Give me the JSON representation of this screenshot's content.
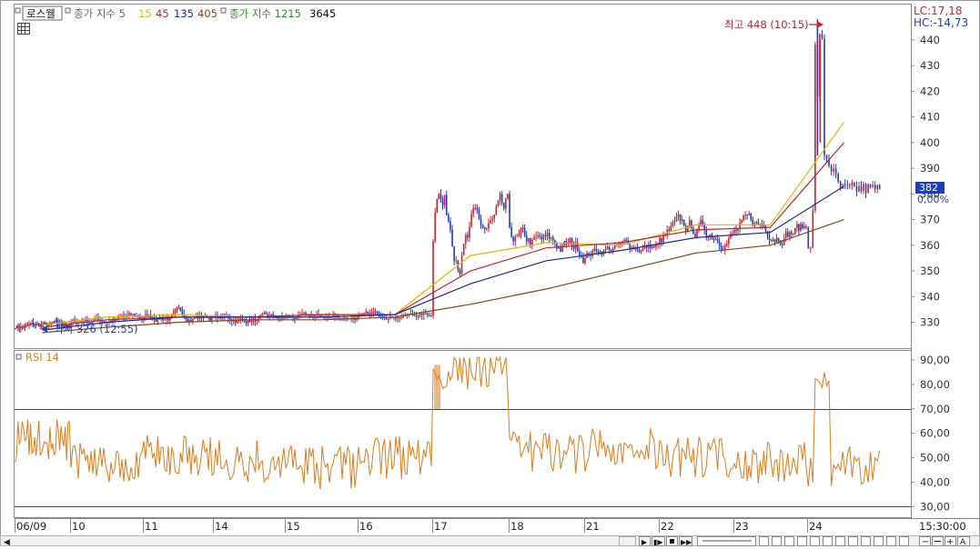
{
  "legend": {
    "stock_name": "로스웰",
    "ma_label": "종가 지수 5",
    "ma_periods": [
      {
        "value": "15",
        "color": "#e8b400"
      },
      {
        "value": "45",
        "color": "#c0282d"
      },
      {
        "value": "135",
        "color": "#1a2a9a"
      },
      {
        "value": "405",
        "color": "#8b4513"
      }
    ],
    "ma2_label": "종가 지수 1215",
    "ma2_value": "3645"
  },
  "price_panel": {
    "lc": "LC:17,18",
    "hc": "HC:-14,73",
    "current_price": "382",
    "current_change": "0,00%",
    "high_annotation": "최고 448 (10:15)",
    "low_annotation": "최저 326 (12:55)",
    "y_ticks": [
      "440",
      "430",
      "420",
      "410",
      "400",
      "390",
      "380",
      "370",
      "360",
      "350",
      "340",
      "330"
    ]
  },
  "rsi_panel": {
    "label": "RSI 14",
    "y_ticks": [
      "90,00",
      "80,00",
      "70,00",
      "60,00",
      "50,00",
      "40,00",
      "30,00"
    ]
  },
  "x_axis": {
    "labels": [
      "06/09",
      "10",
      "11",
      "14",
      "15",
      "16",
      "17",
      "18",
      "21",
      "22",
      "23",
      "24"
    ],
    "time": "15:30:00"
  },
  "colors": {
    "up": "#d0202a",
    "down": "#1f3fb8",
    "rsi": "#e07b1a",
    "ma15": "#e8b400",
    "ma45": "#c0282d",
    "ma135": "#1a2a9a",
    "ma405": "#8b4513"
  },
  "toolbar": {
    "zoom_minus": "−",
    "zoom_plus": "+",
    "a_label": "A"
  },
  "chart_data": [
    {
      "type": "candlestick",
      "x_categories": [
        "06/09",
        "10",
        "11",
        "14",
        "15",
        "16",
        "17",
        "18",
        "21",
        "22",
        "23",
        "24"
      ],
      "ylim": [
        321,
        452
      ],
      "series": [
        {
          "name": "15",
          "values": [
            329,
            332,
            333,
            332,
            333,
            333,
            356,
            361,
            360,
            368,
            368,
            408
          ]
        },
        {
          "name": "45",
          "values": [
            328,
            331,
            332,
            332,
            333,
            333,
            350,
            359,
            361,
            366,
            367,
            400
          ]
        },
        {
          "name": "135",
          "values": [
            327,
            330,
            332,
            332,
            332,
            333,
            345,
            354,
            358,
            363,
            365,
            383
          ]
        },
        {
          "name": "405",
          "values": [
            326,
            328,
            330,
            331,
            331,
            332,
            337,
            343,
            350,
            357,
            360,
            370
          ]
        }
      ],
      "daily_ranges": [
        {
          "x": "06/09",
          "low": 326,
          "high": 331
        },
        {
          "x": "10",
          "low": 328,
          "high": 335
        },
        {
          "x": "11",
          "low": 329,
          "high": 336
        },
        {
          "x": "14",
          "low": 328,
          "high": 334
        },
        {
          "x": "15",
          "low": 330,
          "high": 334
        },
        {
          "x": "16",
          "low": 331,
          "high": 335
        },
        {
          "x": "17",
          "low": 345,
          "high": 380
        },
        {
          "x": "18",
          "low": 350,
          "high": 367
        },
        {
          "x": "21",
          "low": 355,
          "high": 364
        },
        {
          "x": "22",
          "low": 358,
          "high": 373
        },
        {
          "x": "23",
          "low": 360,
          "high": 374
        },
        {
          "x": "24",
          "low": 359,
          "high": 448
        }
      ],
      "high": 448,
      "low": 326,
      "current": 382
    },
    {
      "type": "line",
      "title": "RSI 14",
      "x_categories": [
        "06/09",
        "10",
        "11",
        "14",
        "15",
        "16",
        "17",
        "18",
        "21",
        "22",
        "23",
        "24"
      ],
      "ylim": [
        26,
        93
      ],
      "reference_lines": [
        70,
        30
      ],
      "series": [
        {
          "name": "RSI 14",
          "values": [
            57,
            48,
            51,
            49,
            46,
            50,
            86,
            52,
            53,
            50,
            48,
            46
          ]
        }
      ]
    }
  ]
}
